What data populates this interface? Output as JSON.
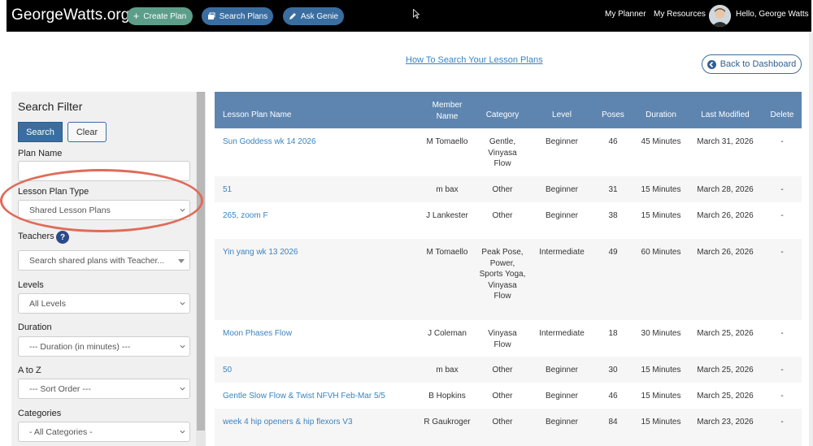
{
  "header": {
    "brand": "GeorgeWatts.org",
    "create_plan": "Create Plan",
    "search_plans": "Search Plans",
    "ask_genie": "Ask Genie",
    "my_planner": "My Planner",
    "my_resources": "My Resources",
    "greeting": "Hello, George Watts"
  },
  "links": {
    "how_to": "How To Search Your Lesson Plans",
    "back": "Back to Dashboard"
  },
  "filter": {
    "title": "Search Filter",
    "search_label": "Search",
    "clear_label": "Clear",
    "plan_name_label": "Plan Name",
    "plan_name_value": "",
    "type_label": "Lesson Plan Type",
    "type_value": "Shared Lesson Plans",
    "teachers_label": "Teachers",
    "teachers_help": "?",
    "teachers_placeholder": "Search shared plans with Teacher...",
    "levels_label": "Levels",
    "levels_value": "All Levels",
    "duration_label": "Duration",
    "duration_value": "--- Duration (in minutes) ---",
    "atoz_label": "A to Z",
    "atoz_value": "--- Sort Order ---",
    "categories_label": "Categories",
    "categories_value": "- All Categories -"
  },
  "table": {
    "headers": {
      "name": "Lesson Plan Name",
      "member": "Member Name",
      "category": "Category",
      "level": "Level",
      "poses": "Poses",
      "duration": "Duration",
      "modified": "Last Modified",
      "delete": "Delete"
    },
    "rows": [
      {
        "name": "Sun Goddess wk 14 2026",
        "member": "M Tomaello",
        "category": "Gentle, Vinyasa Flow",
        "level": "Beginner",
        "poses": "46",
        "duration": "45 Minutes",
        "modified": "March 31, 2026",
        "delete": "-"
      },
      {
        "name": "51",
        "member": "m bax",
        "category": "Other",
        "level": "Beginner",
        "poses": "31",
        "duration": "15 Minutes",
        "modified": "March 28, 2026",
        "delete": "-"
      },
      {
        "name": "265, zoom F",
        "member": "J Lankester",
        "category": "Other",
        "level": "Beginner",
        "poses": "38",
        "duration": "15 Minutes",
        "modified": "March 26, 2026",
        "delete": "-"
      },
      {
        "name": "Yin yang wk 13 2026",
        "member": "M Tomaello",
        "category": "Peak Pose, Power, Sports Yoga, Vinyasa Flow",
        "level": "Intermediate",
        "poses": "49",
        "duration": "60 Minutes",
        "modified": "March 26, 2026",
        "delete": "-"
      },
      {
        "name": "Moon Phases Flow",
        "member": "J Coleman",
        "category": "Vinyasa Flow",
        "level": "Intermediate",
        "poses": "18",
        "duration": "30 Minutes",
        "modified": "March 25, 2026",
        "delete": "-"
      },
      {
        "name": "50",
        "member": "m bax",
        "category": "Other",
        "level": "Beginner",
        "poses": "30",
        "duration": "15 Minutes",
        "modified": "March 25, 2026",
        "delete": "-"
      },
      {
        "name": "Gentle Slow Flow & Twist NFVH Feb-Mar 5/5",
        "member": "B Hopkins",
        "category": "Other",
        "level": "Beginner",
        "poses": "46",
        "duration": "15 Minutes",
        "modified": "March 25, 2026",
        "delete": "-"
      },
      {
        "name": "week 4 hip openers & hip flexors V3",
        "member": "R Gaukroger",
        "category": "Other",
        "level": "Beginner",
        "poses": "84",
        "duration": "15 Minutes",
        "modified": "March 23, 2026",
        "delete": "-"
      }
    ]
  }
}
